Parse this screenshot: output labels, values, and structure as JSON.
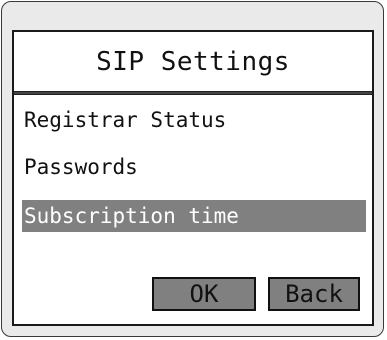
{
  "window": {
    "title": "SIP Settings"
  },
  "menu": {
    "items": [
      {
        "label": "Registrar Status",
        "selected": false
      },
      {
        "label": "Passwords",
        "selected": false
      },
      {
        "label": "Subscription time",
        "selected": true
      }
    ]
  },
  "buttons": {
    "ok_label": "OK",
    "back_label": "Back"
  },
  "colors": {
    "selection_background": "#808080",
    "selection_text": "#ffffff",
    "button_background": "#808080",
    "device_background": "#eaeaea"
  }
}
